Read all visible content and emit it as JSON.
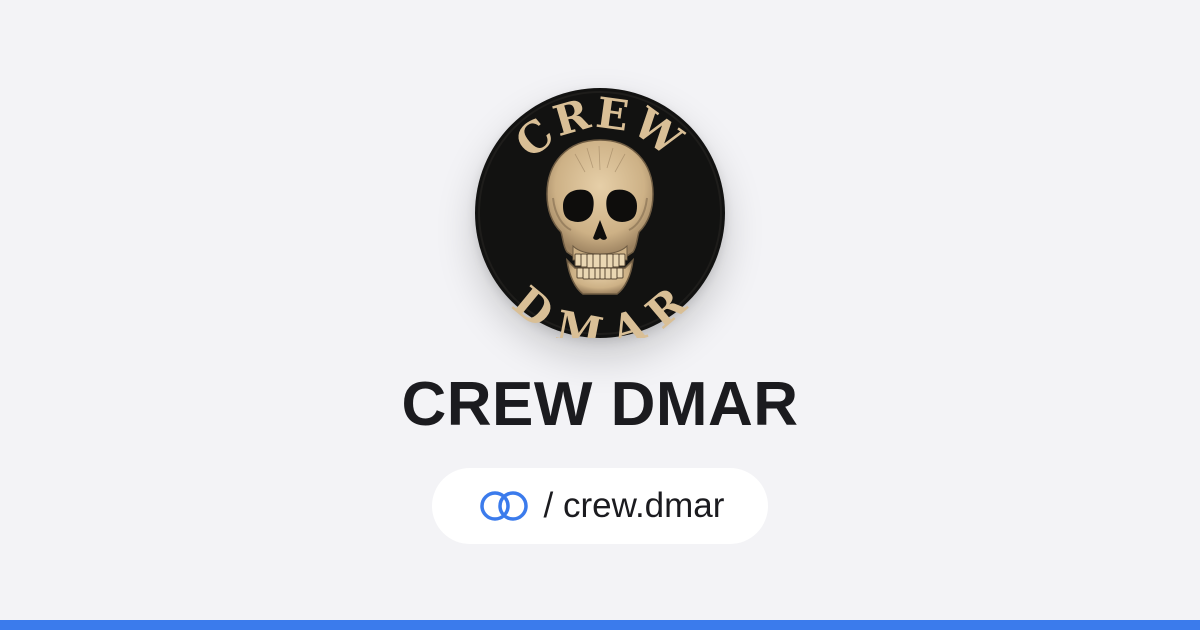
{
  "profile": {
    "name": "CREW DMAR",
    "handle": "/ crew.dmar",
    "avatar": {
      "top_text": "CREW",
      "bottom_text": "DMAR",
      "motif": "skull-emblem"
    }
  },
  "icons": {
    "link": "linked-rings-icon"
  },
  "colors": {
    "background": "#f3f3f6",
    "accent": "#3b7bec",
    "title_text": "#1b1b1f",
    "pill_background": "#ffffff",
    "avatar_background": "#121211",
    "avatar_art": "#d9bf96"
  }
}
